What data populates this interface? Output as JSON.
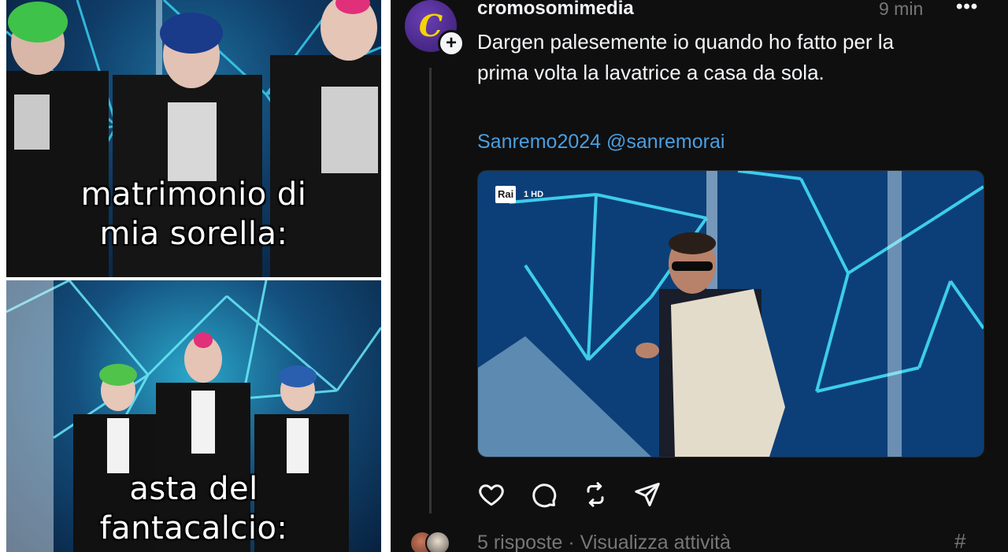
{
  "meme": {
    "caption_top_line1": "matrimonio di",
    "caption_top_line2": "mia sorella:",
    "caption_bottom_line1": "asta del",
    "caption_bottom_line2": "fantacalcio:"
  },
  "post": {
    "avatar_letter": "C",
    "follow_symbol": "+",
    "username": "cromosomimedia",
    "timestamp": "9 min",
    "more_label": "•••",
    "text_line1": "Dargen palesemente io quando ho fatto per la",
    "text_line2": "prima volta la lavatrice a casa da sola.",
    "hashtag_link": "Sanremo2024",
    "mention_link": "@sanremorai",
    "video_logo": "Rai",
    "video_channel": "1 HD",
    "actions": {
      "like_icon": "heart-icon",
      "comment_icon": "comment-icon",
      "repost_icon": "repost-icon",
      "share_icon": "send-icon"
    },
    "replies_label": "5 risposte · Visualizza attività",
    "hash_label": "#"
  },
  "colors": {
    "post_bg": "#0f0f10",
    "text": "#f3f5f7",
    "muted": "#777777",
    "link": "#4a9fe0",
    "avatar_bg": "#4b2a8a",
    "avatar_letter": "#f5d400"
  }
}
